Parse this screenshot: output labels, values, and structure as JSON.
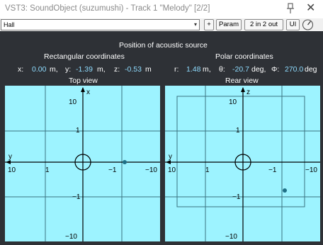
{
  "window": {
    "title": "VST3: SoundObject (suzumushi) - Track 1 \"Melody\" [2/2]"
  },
  "toolbar": {
    "preset_value": "Hall",
    "plus_label": "+",
    "param_label": "Param",
    "io_label": "2 in 2 out",
    "ui_label": "UI"
  },
  "panel": {
    "heading": "Position of acoustic source",
    "rect_heading": "Rectangular coordinates",
    "polar_heading": "Polar coordinates",
    "rect": {
      "x_label": "x:",
      "x_value": "0.00",
      "x_unit": "m,",
      "y_label": "y:",
      "y_value": "-1.39",
      "y_unit": "m,",
      "z_label": "z:",
      "z_value": "-0.53",
      "z_unit": "m"
    },
    "polar": {
      "r_label": "r:",
      "r_value": "1.48",
      "r_unit": "m,",
      "theta_label": "θ:",
      "theta_value": "-20.7",
      "theta_unit": "deg,",
      "phi_label": "Φ:",
      "phi_value": "270.0",
      "phi_unit": "deg"
    }
  },
  "top_view": {
    "title": "Top view",
    "v_axis_label": "x",
    "h_axis_label": "y",
    "tick_top": "10",
    "tick_upper": "1",
    "tick_lower": "−1",
    "tick_bottom": "−10",
    "tick_left": "10",
    "tick_left_inner": "1",
    "tick_right_inner": "−1",
    "tick_right": "−10"
  },
  "rear_view": {
    "title": "Rear view",
    "v_axis_label": "z",
    "h_axis_label": "y",
    "tick_top": "10",
    "tick_upper": "1",
    "tick_lower": "−1",
    "tick_bottom": "−10",
    "tick_left": "10",
    "tick_left_inner": "1",
    "tick_right_inner": "−1",
    "tick_right": "−10"
  },
  "colors": {
    "panel_bg": "#2e3136",
    "view_bg": "#9df3ff",
    "value_text": "#8fdcff",
    "source_dot": "#1f6f86"
  }
}
